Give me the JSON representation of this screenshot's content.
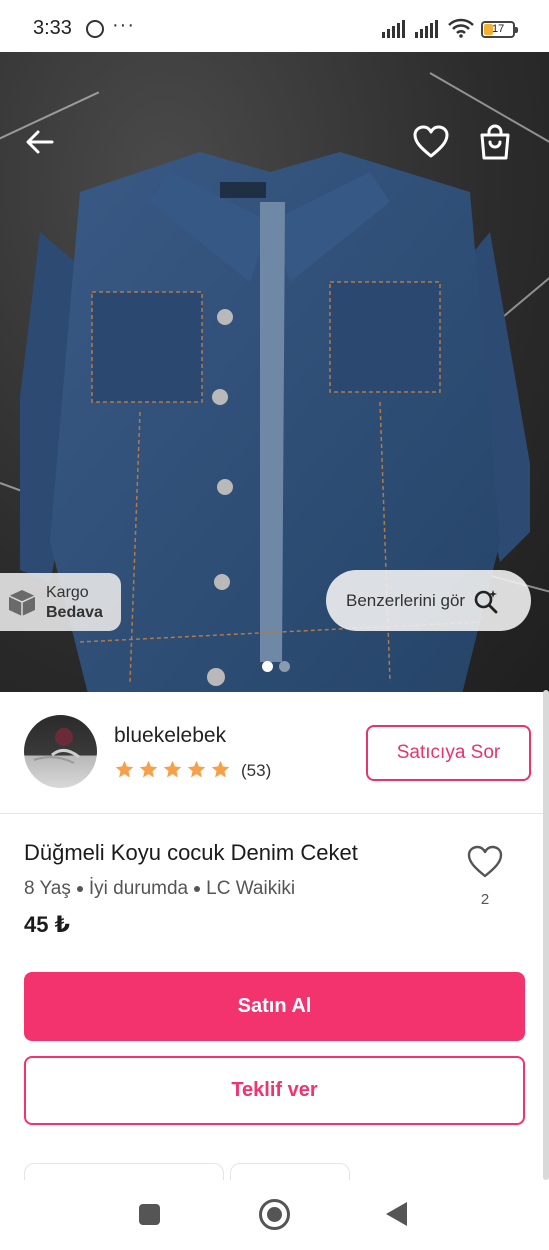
{
  "status_bar": {
    "time": "3:33",
    "more": "···",
    "battery": "17"
  },
  "product": {
    "image_icons": {
      "back": "arrow-left-icon",
      "favorite": "heart-outline-icon",
      "cart": "shopping-bag-icon"
    },
    "cargo_badge": {
      "line1": "Kargo",
      "line2": "Bedava"
    },
    "similar_button": "Benzerlerini gör",
    "image_pages": 2,
    "current_page": 1,
    "title": "Düğmeli Koyu cocuk Denim Ceket",
    "size": "8 Yaş",
    "condition": "İyi durumda",
    "brand": "LC Waikiki",
    "price": "45 ₺",
    "likes": "2"
  },
  "seller": {
    "username": "bluekelebek",
    "rating_stars": 5,
    "rating_count": "(53)",
    "ask_button": "Satıcıya Sor"
  },
  "actions": {
    "buy": "Satın Al",
    "offer": "Teklif ver"
  },
  "colors": {
    "accent": "#f2336e",
    "star": "#f5a04a",
    "denim": "#2f4f77"
  }
}
